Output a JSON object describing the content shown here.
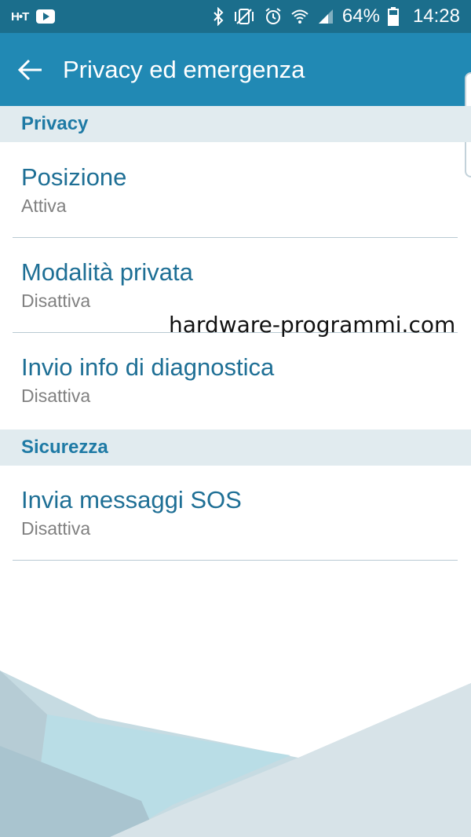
{
  "status_bar": {
    "left_logo": "H•T",
    "battery_text": "64%",
    "time": "14:28"
  },
  "app_bar": {
    "title": "Privacy ed emergenza"
  },
  "sections": [
    {
      "header": "Privacy",
      "items": [
        {
          "title": "Posizione",
          "subtitle": "Attiva"
        },
        {
          "title": "Modalità privata",
          "subtitle": "Disattiva"
        },
        {
          "title": "Invio info di diagnostica",
          "subtitle": "Disattiva"
        }
      ]
    },
    {
      "header": "Sicurezza",
      "items": [
        {
          "title": "Invia messaggi SOS",
          "subtitle": "Disattiva"
        }
      ]
    }
  ],
  "watermark": "hardware-programmi.com",
  "icons": {
    "status_left": [
      "brand-logo-icon",
      "youtube-icon"
    ],
    "status_right": [
      "bluetooth-icon",
      "vibrate-icon",
      "alarm-icon",
      "wifi-icon",
      "signal-icon",
      "battery-icon"
    ],
    "app_bar": "back-arrow-icon"
  },
  "colors": {
    "status_bar": "#1b6e8c",
    "app_bar": "#2189b4",
    "section_header_bg": "#e1ebef",
    "section_header_text": "#1e7aa5",
    "item_title": "#1e6f95",
    "item_subtitle": "#808080"
  }
}
